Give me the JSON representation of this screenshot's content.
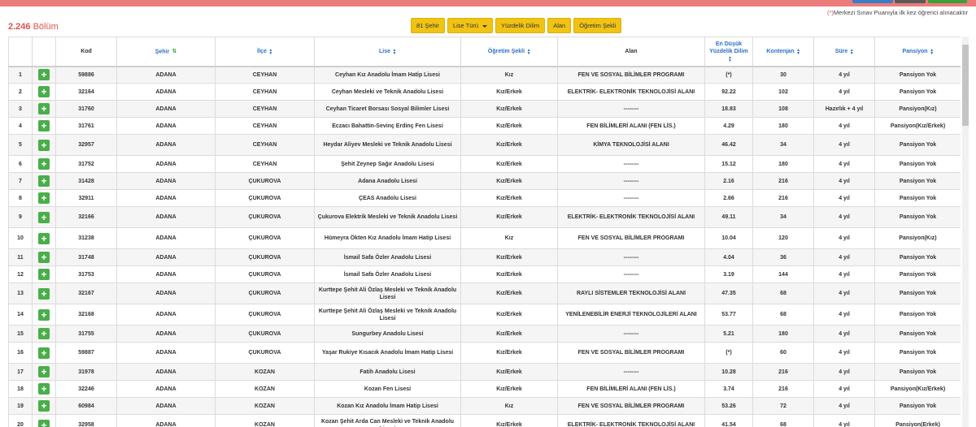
{
  "header": {
    "count": "2.246",
    "count_unit": "Bölüm",
    "note_star": "(*)",
    "note": "Merkezi Sınav Puanıyla ilk kez öğrenci alınacaktır"
  },
  "filters": [
    {
      "label": "81 Şehir",
      "dropdown": false
    },
    {
      "label": "Lise Türü",
      "dropdown": true
    },
    {
      "label": "Yüzdelik Dilim",
      "dropdown": false
    },
    {
      "label": "Alan",
      "dropdown": false
    },
    {
      "label": "Öğretim Şekli",
      "dropdown": false
    }
  ],
  "table": {
    "columns": [
      {
        "label": "",
        "sortable": false
      },
      {
        "label": "",
        "sortable": false
      },
      {
        "label": "Kod",
        "sortable": false
      },
      {
        "label": "Şehir",
        "sortable": true,
        "active": true
      },
      {
        "label": "İlçe",
        "sortable": true
      },
      {
        "label": "Lise",
        "sortable": true
      },
      {
        "label": "Öğretim Şekli",
        "sortable": true
      },
      {
        "label": "Alan",
        "sortable": false
      },
      {
        "label": "En Düşük Yüzdelik Dilim",
        "sortable": true
      },
      {
        "label": "Kontenjan",
        "sortable": true
      },
      {
        "label": "Süre",
        "sortable": true
      },
      {
        "label": "Pansiyon",
        "sortable": true
      }
    ],
    "rows": [
      [
        "1",
        "59886",
        "ADANA",
        "CEYHAN",
        "Ceyhan Kız Anadolu İmam Hatip Lisesi",
        "Kız",
        "FEN VE SOSYAL BİLİMLER PROGRAMI",
        "(*)",
        "30",
        "4 yıl",
        "Pansiyon Yok"
      ],
      [
        "2",
        "32164",
        "ADANA",
        "CEYHAN",
        "Ceyhan Mesleki ve Teknik Anadolu Lisesi",
        "Kız/Erkek",
        "ELEKTRİK- ELEKTRONİK TEKNOLOJİSİ ALANI",
        "92.22",
        "102",
        "4 yıl",
        "Pansiyon Yok"
      ],
      [
        "3",
        "31760",
        "ADANA",
        "CEYHAN",
        "Ceyhan Ticaret Borsası Sosyal Bilimler Lisesi",
        "Kız/Erkek",
        "--------",
        "18.83",
        "108",
        "Hazırlık + 4 yıl",
        "Pansiyon(Kız)"
      ],
      [
        "4",
        "31761",
        "ADANA",
        "CEYHAN",
        "Eczacı Bahattin-Sevinç Erdinç Fen Lisesi",
        "Kız/Erkek",
        "FEN BİLİMLERİ ALANI (FEN LİS.)",
        "4.29",
        "180",
        "4 yıl",
        "Pansiyon(Kız/Erkek)"
      ],
      [
        "5",
        "32957",
        "ADANA",
        "CEYHAN",
        "Heydar Aliyev Mesleki ve Teknik Anadolu Lisesi",
        "Kız/Erkek",
        "KİMYA TEKNOLOJİSİ ALANI",
        "46.42",
        "34",
        "4 yıl",
        "Pansiyon Yok"
      ],
      [
        "6",
        "31752",
        "ADANA",
        "CEYHAN",
        "Şehit Zeynep Sağır Anadolu Lisesi",
        "Kız/Erkek",
        "--------",
        "15.12",
        "180",
        "4 yıl",
        "Pansiyon Yok"
      ],
      [
        "7",
        "31428",
        "ADANA",
        "ÇUKUROVA",
        "Adana Anadolu Lisesi",
        "Kız/Erkek",
        "--------",
        "2.16",
        "216",
        "4 yıl",
        "Pansiyon Yok"
      ],
      [
        "8",
        "32911",
        "ADANA",
        "ÇUKUROVA",
        "ÇEAS Anadolu Lisesi",
        "Kız/Erkek",
        "--------",
        "2.66",
        "216",
        "4 yıl",
        "Pansiyon Yok"
      ],
      [
        "9",
        "32166",
        "ADANA",
        "ÇUKUROVA",
        "Çukurova Elektrik Mesleki ve Teknik Anadolu Lisesi",
        "Kız/Erkek",
        "ELEKTRİK- ELEKTRONİK TEKNOLOJİSİ ALANI",
        "49.11",
        "34",
        "4 yıl",
        "Pansiyon Yok"
      ],
      [
        "10",
        "31238",
        "ADANA",
        "ÇUKUROVA",
        "Hümeyra Ökten Kız Anadolu İmam Hatip Lisesi",
        "Kız",
        "FEN VE SOSYAL BİLİMLER PROGRAMI",
        "10.04",
        "120",
        "4 yıl",
        "Pansiyon(Kız)"
      ],
      [
        "11",
        "31748",
        "ADANA",
        "ÇUKUROVA",
        "İsmail Safa Özler Anadolu Lisesi",
        "Kız/Erkek",
        "--------",
        "4.04",
        "36",
        "4 yıl",
        "Pansiyon Yok"
      ],
      [
        "12",
        "31753",
        "ADANA",
        "ÇUKUROVA",
        "İsmail Safa Özler Anadolu Lisesi",
        "Kız/Erkek",
        "--------",
        "3.19",
        "144",
        "4 yıl",
        "Pansiyon Yok"
      ],
      [
        "13",
        "32167",
        "ADANA",
        "ÇUKUROVA",
        "Kurttepe Şehit Ali Özlaş Mesleki ve Teknik Anadolu Lisesi",
        "Kız/Erkek",
        "RAYLI SİSTEMLER TEKNOLOJİSİ ALANI",
        "47.35",
        "68",
        "4 yıl",
        "Pansiyon Yok"
      ],
      [
        "14",
        "32168",
        "ADANA",
        "ÇUKUROVA",
        "Kurttepe Şehit Ali Özlaş Mesleki ve Teknik Anadolu Lisesi",
        "Kız/Erkek",
        "YENİLENEBİLİR ENERJİ TEKNOLOJİLERİ ALANI",
        "53.77",
        "68",
        "4 yıl",
        "Pansiyon Yok"
      ],
      [
        "15",
        "31755",
        "ADANA",
        "ÇUKUROVA",
        "Sungurbey Anadolu Lisesi",
        "Kız/Erkek",
        "--------",
        "5.21",
        "180",
        "4 yıl",
        "Pansiyon Yok"
      ],
      [
        "16",
        "59887",
        "ADANA",
        "ÇUKUROVA",
        "Yaşar Rukiye Kısacık Anadolu İmam Hatip Lisesi",
        "Kız/Erkek",
        "FEN VE SOSYAL BİLİMLER PROGRAMI",
        "(*)",
        "60",
        "4 yıl",
        "Pansiyon Yok"
      ],
      [
        "17",
        "31978",
        "ADANA",
        "KOZAN",
        "Fatih Anadolu Lisesi",
        "Kız/Erkek",
        "--------",
        "10.28",
        "216",
        "4 yıl",
        "Pansiyon Yok"
      ],
      [
        "18",
        "32246",
        "ADANA",
        "KOZAN",
        "Kozan Fen Lisesi",
        "Kız/Erkek",
        "FEN BİLİMLERİ ALANI (FEN LİS.)",
        "3.74",
        "216",
        "4 yıl",
        "Pansiyon(Kız/Erkek)"
      ],
      [
        "19",
        "60984",
        "ADANA",
        "KOZAN",
        "Kozan Kız Anadolu İmam Hatip Lisesi",
        "Kız",
        "FEN VE SOSYAL BİLİMLER PROGRAMI",
        "53.26",
        "72",
        "4 yıl",
        "Pansiyon Yok"
      ],
      [
        "20",
        "32958",
        "ADANA",
        "KOZAN",
        "Kozan Şehit Arda Can Mesleki ve Teknik Anadolu Lisesi",
        "Kız/Erkek",
        "ELEKTRİK- ELEKTRONİK TEKNOLOJİSİ ALANI",
        "41.54",
        "68",
        "4 yıl",
        "Pansiyon(Erkek)"
      ]
    ],
    "tall_rows": [
      5,
      9,
      10,
      13,
      14,
      16,
      20
    ],
    "add_label": "+"
  }
}
